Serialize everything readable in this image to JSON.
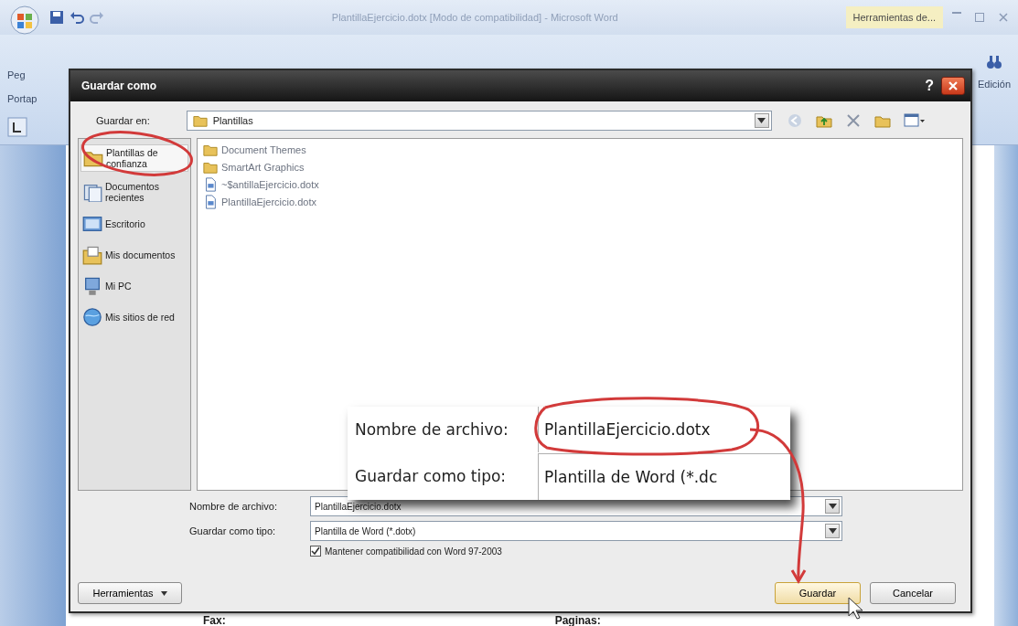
{
  "word_window": {
    "title": "PlantillaEjercicio.dotx [Modo de compatibilidad] - Microsoft Word",
    "contextual_tab": "Herramientas de...",
    "ribbon_left": [
      "Peg",
      "Portap"
    ],
    "ribbon_right": "Edición",
    "document_texts": [
      "Fax:",
      "Paginas:"
    ]
  },
  "dialog": {
    "title": "Guardar como",
    "help": "?",
    "save_in_label": "Guardar en:",
    "save_in_value": "Plantillas",
    "places": [
      {
        "label": "Plantillas de confianza",
        "kind": "folder",
        "selected": true
      },
      {
        "label": "Documentos recientes",
        "kind": "recent",
        "selected": false
      },
      {
        "label": "Escritorio",
        "kind": "desktop",
        "selected": false
      },
      {
        "label": "Mis documentos",
        "kind": "documents",
        "selected": false
      },
      {
        "label": "Mi PC",
        "kind": "computer",
        "selected": false
      },
      {
        "label": "Mis sitios de red",
        "kind": "network",
        "selected": false
      }
    ],
    "files": [
      {
        "name": "Document Themes",
        "kind": "folder"
      },
      {
        "name": "SmartArt Graphics",
        "kind": "folder"
      },
      {
        "name": "~$antillaEjercicio.dotx",
        "kind": "file"
      },
      {
        "name": "PlantillaEjercicio.dotx",
        "kind": "file"
      }
    ],
    "filename_label": "Nombre de archivo:",
    "filename": "PlantillaEjercicio.dotx",
    "type_label": "Guardar como tipo:",
    "type": "Plantilla de Word (*.dotx)",
    "compat": {
      "label": "Mantener compatibilidad con Word 97-2003",
      "checked": true
    },
    "buttons": [
      {
        "label": "Herramientas",
        "kind": "menu"
      },
      {
        "label": "Guardar",
        "kind": "primary"
      },
      {
        "label": "Cancelar",
        "kind": "plain"
      }
    ]
  },
  "callout": {
    "filename_label": "Nombre de archivo:",
    "filename": "PlantillaEjercicio.dotx",
    "type_label": "Guardar como tipo:",
    "type": "Plantilla de Word (*.dc"
  }
}
